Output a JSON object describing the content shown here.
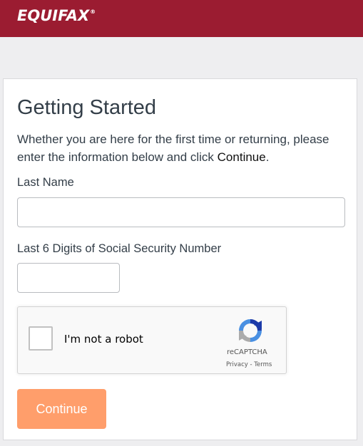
{
  "header": {
    "brand": "EQUIFAX",
    "brand_mark": "®",
    "color": "#9b1c31"
  },
  "form": {
    "title": "Getting Started",
    "intro_text": "Whether you are here for the first time or returning, please enter the information below and click ",
    "intro_emphasis": "Continue",
    "intro_end": ".",
    "last_name_label": "Last Name",
    "last_name_value": "",
    "ssn_label": "Last 6 Digits of Social Security Number",
    "ssn_value": "",
    "continue_label": "Continue",
    "continue_color": "#ff9e6b"
  },
  "recaptcha": {
    "checkbox_label": "I'm not a robot",
    "checked": false,
    "brand": "reCAPTCHA",
    "privacy_label": "Privacy",
    "separator": " - ",
    "terms_label": "Terms",
    "icon": "recaptcha-logo-icon"
  }
}
